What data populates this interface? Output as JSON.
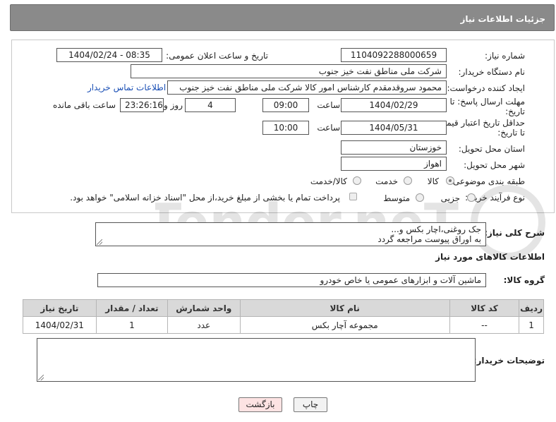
{
  "header": {
    "title": "جزئیات اطلاعات نیاز"
  },
  "form": {
    "need_number_label": "شماره نیاز:",
    "need_number": "1104092288000659",
    "announce_label": "تاریخ و ساعت اعلان عمومی:",
    "announce_value": "1404/02/24 - 08:35",
    "buyer_org_label": "نام دستگاه خریدار:",
    "buyer_org": "شرکت ملی مناطق نفت خیز جنوب",
    "creator_label": "ایجاد کننده درخواست:",
    "creator": "محمود سروقدمقدم کارشناس امور کالا شرکت ملی مناطق نفت خیز جنوب",
    "buyer_contact_link": "اطلاعات تماس خریدار",
    "reply_deadline_label_1": "مهلت ارسال پاسخ: تا",
    "reply_deadline_label_2": "تاریخ:",
    "reply_date": "1404/02/29",
    "time_label": "ساعت",
    "reply_time": "09:00",
    "days_value": "4",
    "days_label": "روز و",
    "remaining_time": "23:26:16",
    "remaining_label": "ساعت باقی مانده",
    "price_validity_label_1": "حداقل تاریخ اعتبار قیمت:",
    "price_validity_label_2": "تا تاریخ:",
    "price_date": "1404/05/31",
    "price_time_label": "ساعت",
    "price_time": "10:00",
    "province_label": "استان محل تحویل:",
    "province": "خوزستان",
    "city_label": "شهر محل تحویل:",
    "city": "اهواز",
    "category_label": "طبقه بندی موضوعی:",
    "category_options": [
      "کالا",
      "خدمت",
      "کالا/خدمت"
    ],
    "category_selected": "کالا",
    "process_label": "نوع فرآیند خرید :",
    "process_options": [
      "جزیی",
      "متوسط"
    ],
    "payment_note": "پرداخت تمام یا بخشی از مبلغ خرید،از محل \"اسناد خزانه اسلامی\" خواهد بود."
  },
  "description": {
    "label": "شرح کلی نیاز:",
    "line1": "جک روغنی،اچار بکس و...",
    "line2": "به اوراق پیوست مراجعه گردد"
  },
  "goods": {
    "section_title": "اطلاعات کالاهای مورد نیاز",
    "group_label": "گروه کالا:",
    "group_value": "ماشین آلات و ابزارهای عمومی یا خاص خودرو",
    "columns": [
      "ردیف",
      "کد کالا",
      "نام کالا",
      "واحد شمارش",
      "تعداد / مقدار",
      "تاریخ نیاز"
    ],
    "rows": [
      {
        "row": "1",
        "code": "--",
        "name": "مجموعه آچار بکس",
        "unit": "عدد",
        "qty": "1",
        "date": "1404/02/31"
      }
    ]
  },
  "notes": {
    "label": "توضیحات خریدار:"
  },
  "buttons": {
    "print": "چاپ",
    "back": "بازگشت"
  },
  "watermark": "AriaTender.neT",
  "colors": {
    "header_bg": "#8a8a8a",
    "link": "#1a4fb5",
    "back_btn": "#fde3e3"
  }
}
